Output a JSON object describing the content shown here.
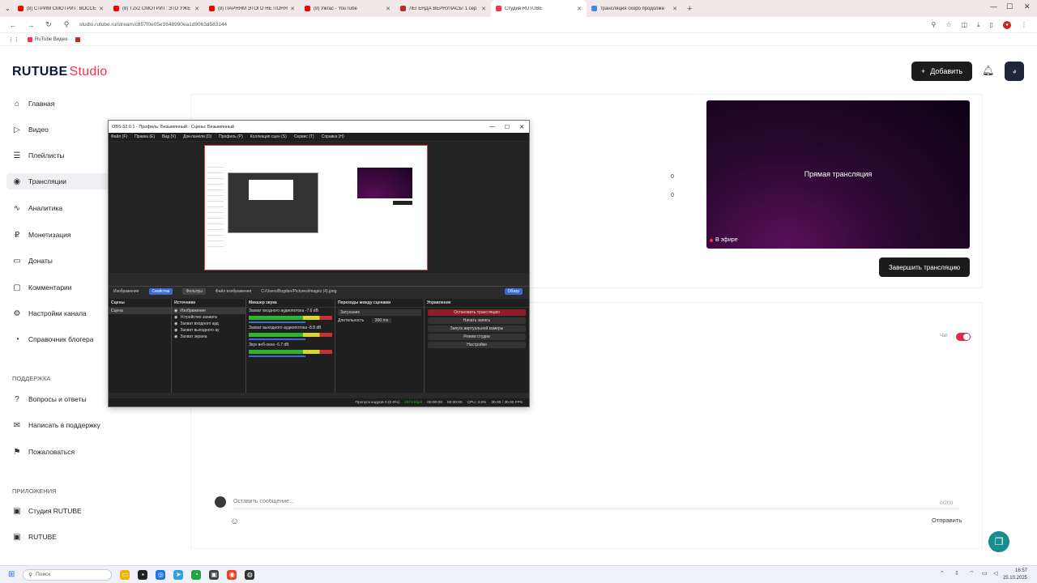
{
  "browser": {
    "tabs": [
      {
        "title": "(8) СТРИМ СМОТРИТ: ВОССЕ",
        "favicon_color": "#ff0000",
        "active": false
      },
      {
        "title": "(8) T2x2 СМОТРИТ: ЭТО УЖЕ",
        "favicon_color": "#ff0000",
        "active": false
      },
      {
        "title": "(8) ПАРНЯМ ЭТОГО НЕ ПОНЯ",
        "favicon_color": "#ff0000",
        "active": false
      },
      {
        "title": "(8) Ужгас - YouTube",
        "favicon_color": "#ff0000",
        "active": false
      },
      {
        "title": "ЛЕГЕНДА ВЕРНУЛАСЬ! 1 сер",
        "favicon_color": "#c62828",
        "active": false
      },
      {
        "title": "Студия RUTUBE",
        "favicon_color": "#ff2d55",
        "active": true
      },
      {
        "title": "трансляция скоро продолже",
        "favicon_color": "#4285f4",
        "active": false
      }
    ],
    "new_tab": "+",
    "url": "studio.rutube.ru/stream/c857f0e05e1648990ea1d9063d583144",
    "bookmarks": [
      "RuTube Видео",
      ""
    ]
  },
  "header": {
    "logo_main": "RUTUBE",
    "logo_studio": "Studio",
    "add_label": "Добавить"
  },
  "sidebar": {
    "items": [
      {
        "label": "Главная",
        "icon": "home-icon",
        "glyph": "⌂"
      },
      {
        "label": "Видео",
        "icon": "video-icon",
        "glyph": "▷"
      },
      {
        "label": "Плейлисты",
        "icon": "playlist-icon",
        "glyph": "☰"
      },
      {
        "label": "Трансляции",
        "icon": "broadcast-icon",
        "glyph": "◉"
      },
      {
        "label": "Аналитика",
        "icon": "analytics-icon",
        "glyph": "∿"
      },
      {
        "label": "Монетизация",
        "icon": "monetization-icon",
        "glyph": "₽"
      },
      {
        "label": "Донаты",
        "icon": "donate-icon",
        "glyph": "▭"
      },
      {
        "label": "Комментарии",
        "icon": "comments-icon",
        "glyph": "▢"
      },
      {
        "label": "Настройки канала",
        "icon": "settings-icon",
        "glyph": "⚙"
      },
      {
        "label": "Справочник блогера",
        "icon": "guide-icon",
        "glyph": "◔"
      }
    ],
    "support_heading": "ПОДДЕРЖКА",
    "support_items": [
      {
        "label": "Вопросы и ответы",
        "icon": "help-icon",
        "glyph": "?"
      },
      {
        "label": "Написать в поддержку",
        "icon": "mail-icon",
        "glyph": "✉"
      },
      {
        "label": "Пожаловаться",
        "icon": "flag-icon",
        "glyph": "⚑"
      }
    ],
    "apps_heading": "ПРИЛОЖЕНИЯ",
    "apps_items": [
      {
        "label": "Студия RUTUBE",
        "icon": "studio-app-icon",
        "glyph": "▣"
      },
      {
        "label": "RUTUBE",
        "icon": "rutube-app-icon",
        "glyph": "▣"
      }
    ]
  },
  "stream": {
    "preview_title": "Прямая трансляция",
    "live_badge": "В эфире",
    "end_button": "Завершить трансляцию",
    "stat_1": "0",
    "stat_2": "0"
  },
  "chat": {
    "toggle_label": "Чат",
    "placeholder": "Оставить сообщение...",
    "counter": "0/200",
    "send_label": "Отправить"
  },
  "obs": {
    "title": "OBS 32.0.1 - Профиль: Безымянный - Сцены: Безымянный",
    "menu": [
      "Файл (F)",
      "Правка (E)",
      "Вид (V)",
      "Док-панели (D)",
      "Профиль (P)",
      "Коллекция сцен (S)",
      "Сервис (T)",
      "Справка (H)"
    ],
    "toolbar": {
      "source": "Изображение",
      "props": "Свойства",
      "filters": "Фильтры",
      "file_label": "Файл изображения",
      "path": "C:/Users/Bogdan/Pictures/images (4).jpeg",
      "browse": "Обзор"
    },
    "docks": {
      "scenes_title": "Сцены",
      "scenes": [
        "Сцена"
      ],
      "sources_title": "Источники",
      "sources": [
        "Изображение",
        "Устройство захвата",
        "Захват входного ауд",
        "Захват выходного ау",
        "Захват экрана"
      ],
      "mixer_title": "Микшер звука",
      "mixer": [
        {
          "name": "Захват входного аудиопотока",
          "db": "-7.6 dB"
        },
        {
          "name": "Захват выходного аудиопотока",
          "db": "-8.8 dB"
        },
        {
          "name": "Звук веб-окна",
          "db": "-6.7 dB"
        }
      ],
      "transitions_title": "Переходы между сценами",
      "transition": "Затухание",
      "duration_label": "Длительность",
      "duration": "300 ms",
      "controls_title": "Управление",
      "controls": [
        "Остановить трансляцию",
        "Начать запись",
        "Запуск виртуальной камеры",
        "Режим студии",
        "Настройки"
      ]
    },
    "status": {
      "dropped": "Пропуск кадров 0 (0.0%)",
      "kbps": "2674 kbps",
      "stream_time": "00:00:08",
      "rec_time": "00:00:00",
      "cpu": "CPU: 3.6%",
      "fps": "30.00 / 30.00 FPS"
    }
  },
  "taskbar": {
    "search": "Поиск",
    "time": "16:57",
    "date": "25.10.2025"
  },
  "colors": {
    "accent": "#ff2d55",
    "dark_button": "#1c1c1c",
    "fab": "#1a8b8f"
  }
}
